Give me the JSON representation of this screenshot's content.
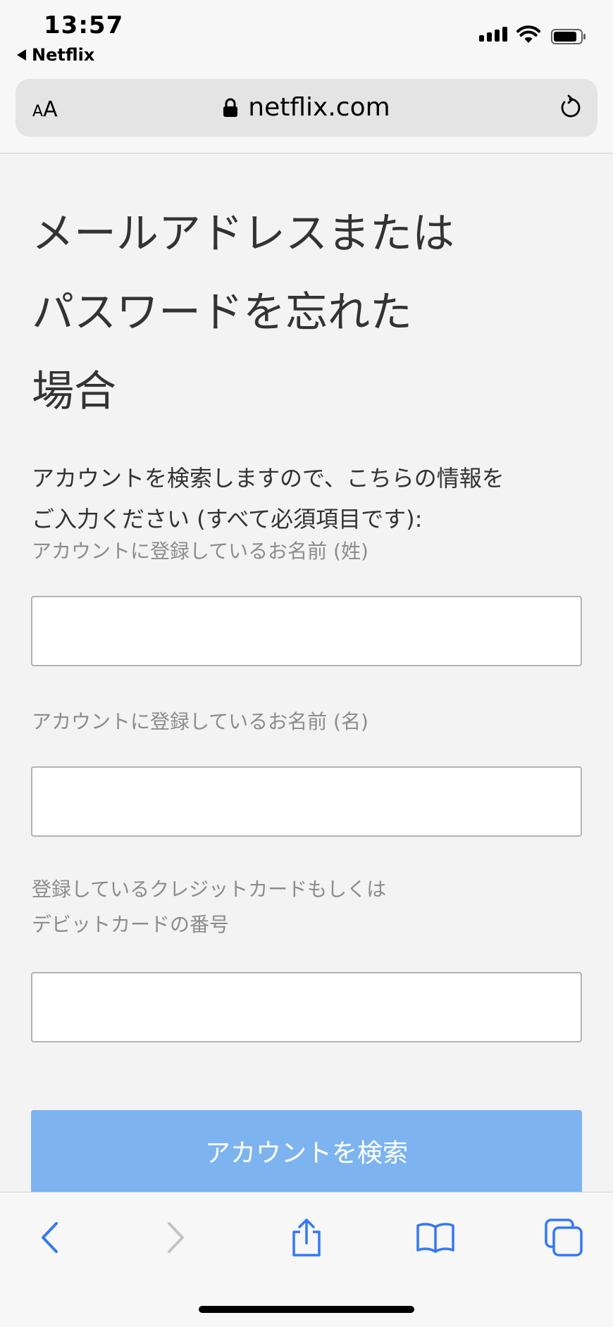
{
  "status_bar": {
    "time": "13:57",
    "back_app": "Netflix",
    "icons": [
      "cellular-signal-icon",
      "wifi-icon",
      "battery-icon"
    ]
  },
  "browser": {
    "text_size_button": "AA",
    "url": "netflix.com",
    "icons": [
      "lock-icon",
      "reload-icon"
    ]
  },
  "page": {
    "title_lines": [
      "メールアドレスまたは",
      "パスワードを忘れた",
      "場合"
    ],
    "description_lines": [
      "アカウントを検索しますので、こちらの情報を",
      "ご入力ください (すべて必須項目です):"
    ],
    "fields": [
      {
        "label_lines": [
          "アカウントに登録しているお名前 (姓)"
        ],
        "value": ""
      },
      {
        "label_lines": [
          "アカウントに登録しているお名前 (名)"
        ],
        "value": ""
      },
      {
        "label_lines": [
          "登録しているクレジットカードもしくは",
          "デビットカードの番号"
        ],
        "value": ""
      }
    ],
    "submit_label": "アカウントを検索"
  },
  "toolbar": {
    "icons": [
      "back-icon",
      "forward-icon",
      "share-icon",
      "bookmarks-icon",
      "tabs-icon"
    ]
  },
  "colors": {
    "accent": "#3478f6",
    "submit_bg": "#7db4ef",
    "label_gray": "#8c8c8c",
    "page_bg": "#f3f3f3"
  }
}
